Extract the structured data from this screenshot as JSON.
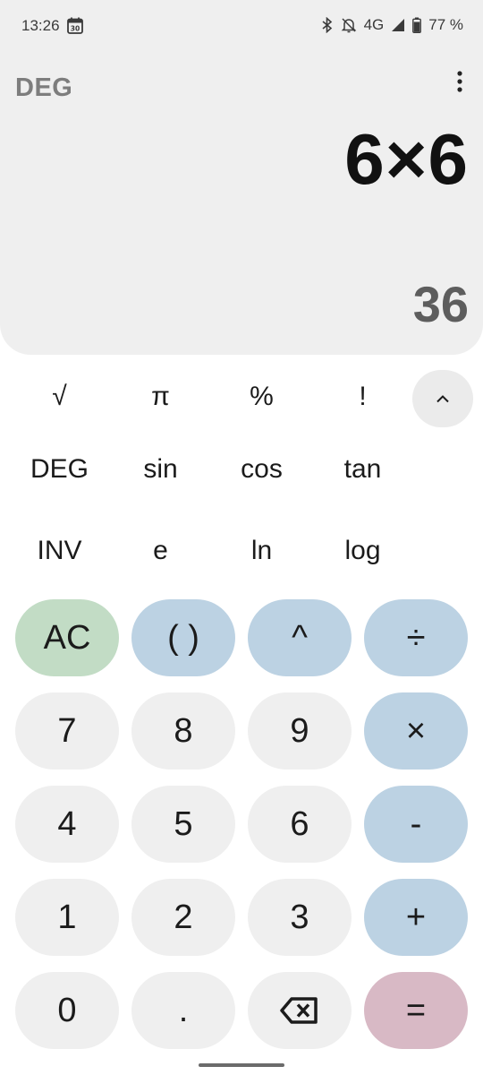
{
  "status_bar": {
    "time": "13:26",
    "calendar_day": "30",
    "network": "4G",
    "battery": "77 %"
  },
  "display": {
    "angle_mode": "DEG",
    "expression": "6×6",
    "result": "36"
  },
  "scientific": {
    "row1": [
      "√",
      "π",
      "%",
      "!"
    ],
    "row2": [
      "DEG",
      "sin",
      "cos",
      "tan"
    ],
    "row3": [
      "INV",
      "e",
      "ln",
      "log"
    ]
  },
  "keypad": {
    "clear": "AC",
    "parens": "( )",
    "power": "^",
    "divide": "÷",
    "seven": "7",
    "eight": "8",
    "nine": "9",
    "multiply": "×",
    "four": "4",
    "five": "5",
    "six": "6",
    "minus": "-",
    "one": "1",
    "two": "2",
    "three": "3",
    "plus": "+",
    "zero": "0",
    "decimal": ".",
    "backspace_icon": "backspace-icon",
    "equals": "="
  },
  "colors": {
    "display_bg": "#efefef",
    "operator_key": "#bcd2e3",
    "clear_key": "#c2dcc5",
    "equals_key": "#d8b9c5",
    "number_key": "#efefef"
  }
}
